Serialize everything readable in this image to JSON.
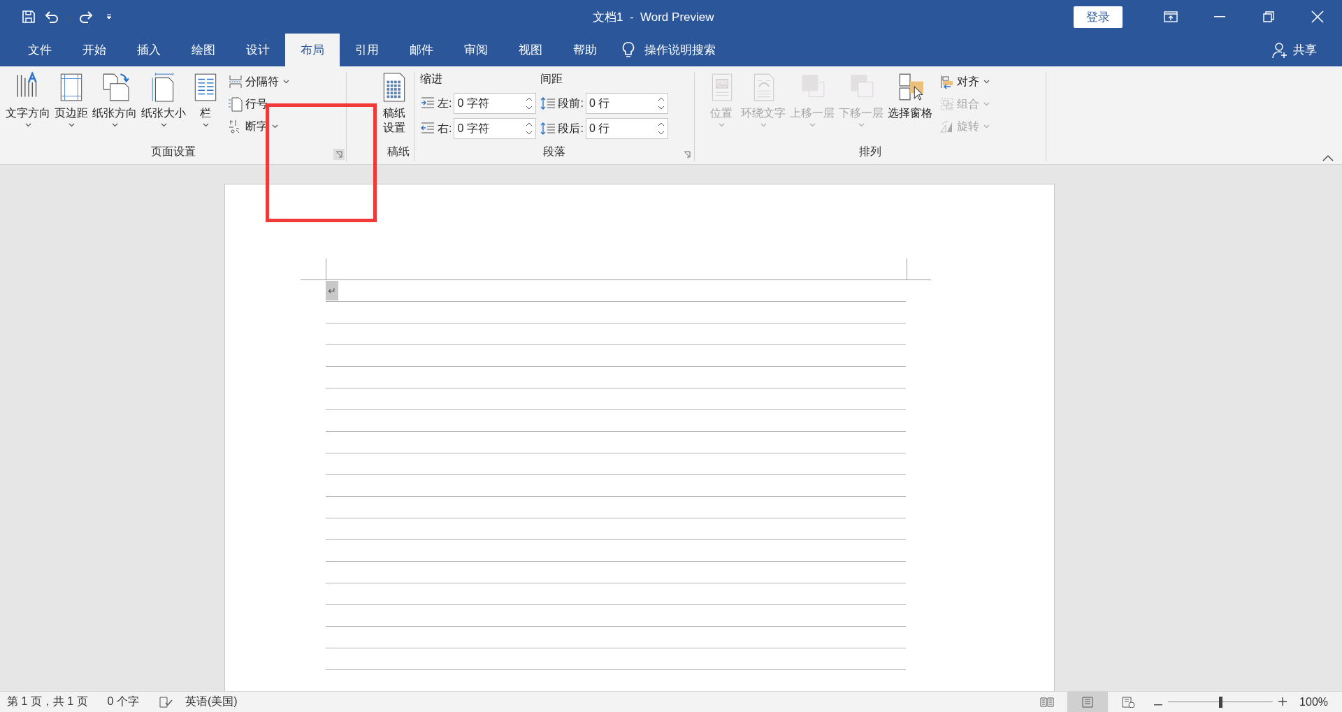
{
  "window": {
    "title": "文档1  -  Word Preview",
    "sign_in": "登录"
  },
  "tabs": [
    {
      "label": "文件",
      "selected": false
    },
    {
      "label": "开始",
      "selected": false
    },
    {
      "label": "插入",
      "selected": false
    },
    {
      "label": "绘图",
      "selected": false
    },
    {
      "label": "设计",
      "selected": false
    },
    {
      "label": "布局",
      "selected": true
    },
    {
      "label": "引用",
      "selected": false
    },
    {
      "label": "邮件",
      "selected": false
    },
    {
      "label": "审阅",
      "selected": false
    },
    {
      "label": "视图",
      "selected": false
    },
    {
      "label": "帮助",
      "selected": false
    }
  ],
  "search": {
    "placeholder": "操作说明搜索"
  },
  "share": "共享",
  "ribbon": {
    "page_setup": {
      "label": "页面设置",
      "large": [
        {
          "label": "文字方向",
          "dropdown": true
        },
        {
          "label": "页边距",
          "dropdown": true
        },
        {
          "label": "纸张方向",
          "dropdown": true
        },
        {
          "label": "纸张大小",
          "dropdown": true
        },
        {
          "label": "栏",
          "dropdown": true
        }
      ],
      "small": [
        {
          "label": "分隔符",
          "dropdown": true
        },
        {
          "label": "行号",
          "dropdown": false
        },
        {
          "label": "断字",
          "dropdown": true
        }
      ]
    },
    "manuscript": {
      "label": "稿纸",
      "button": "稿纸设置"
    },
    "paragraph": {
      "label": "段落",
      "indent": {
        "heading": "缩进",
        "fields": [
          {
            "label": "左:",
            "value": "0 字符"
          },
          {
            "label": "右:",
            "value": "0 字符"
          }
        ]
      },
      "spacing": {
        "heading": "间距",
        "fields": [
          {
            "label": "段前:",
            "value": "0 行"
          },
          {
            "label": "段后:",
            "value": "0 行"
          }
        ]
      }
    },
    "arrange": {
      "label": "排列",
      "large": [
        {
          "label": "位置",
          "disabled": true,
          "dropdown": true
        },
        {
          "label": "环绕文字",
          "disabled": true,
          "dropdown": true
        },
        {
          "label": "上移一层",
          "disabled": true,
          "dropdown": true
        },
        {
          "label": "下移一层",
          "disabled": true,
          "dropdown": true
        },
        {
          "label": "选择窗格",
          "disabled": false,
          "dropdown": false
        }
      ],
      "small": [
        {
          "label": "对齐",
          "disabled": false
        },
        {
          "label": "组合",
          "disabled": true
        },
        {
          "label": "旋转",
          "disabled": true
        }
      ]
    }
  },
  "document": {
    "paragraph_mark": "↵"
  },
  "status_bar": {
    "page": "第 1 页，共 1 页",
    "words": "0 个字",
    "language": "英语(美国)",
    "views": [
      {
        "selected": false
      },
      {
        "selected": true
      },
      {
        "selected": false
      }
    ],
    "zoom": {
      "level": 0.5,
      "reading": "100%"
    }
  }
}
